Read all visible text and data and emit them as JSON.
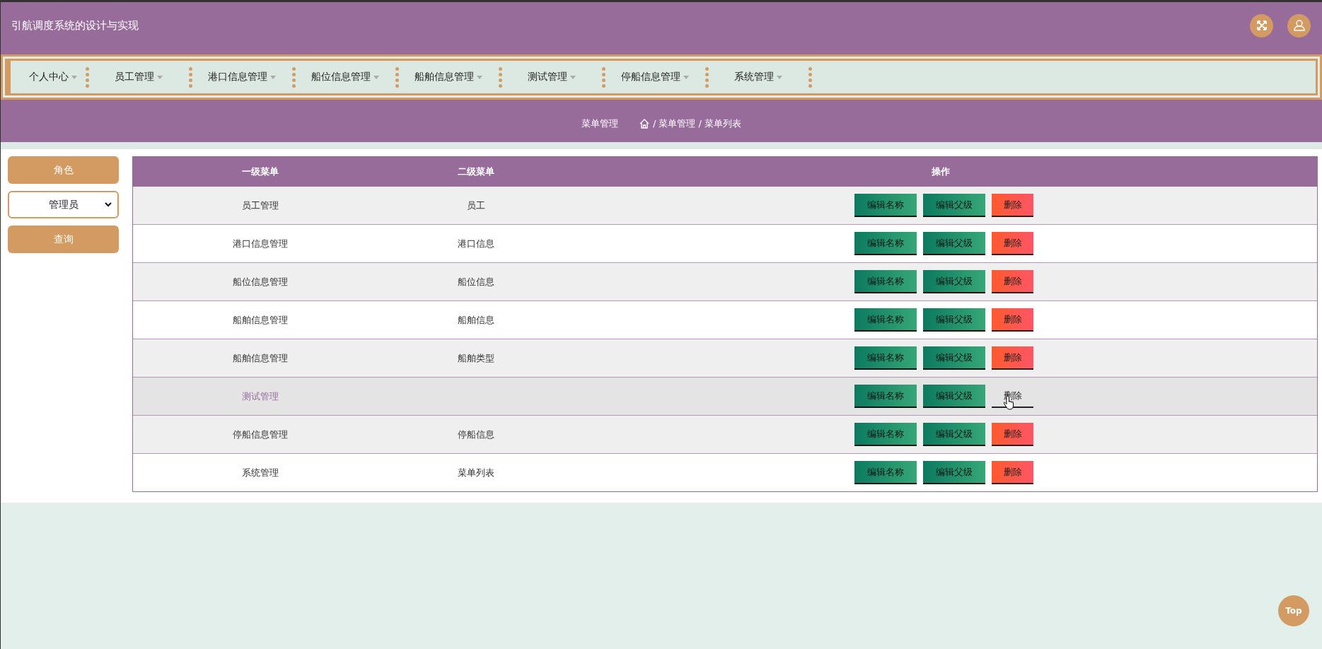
{
  "header": {
    "title": "引航调度系统的设计与实现"
  },
  "nav": [
    {
      "label": "个人中心"
    },
    {
      "label": "员工管理"
    },
    {
      "label": "港口信息管理"
    },
    {
      "label": "船位信息管理"
    },
    {
      "label": "船舶信息管理"
    },
    {
      "label": "测试管理"
    },
    {
      "label": "停船信息管理"
    },
    {
      "label": "系统管理"
    }
  ],
  "breadcrumb": {
    "title": "菜单管理",
    "path": "/ 菜单管理 / 菜单列表"
  },
  "sidebar": {
    "role_label": "角色",
    "role_select": "管理员",
    "query_button": "查询"
  },
  "table": {
    "columns": [
      "一级菜单",
      "二级菜单",
      "操作"
    ],
    "rows": [
      {
        "menu_level_1": "员工管理",
        "menu_level_2": "员工",
        "hovered": false,
        "actions": [
          "编辑名称",
          "编辑父级",
          "删除"
        ]
      },
      {
        "menu_level_1": "港口信息管理",
        "menu_level_2": "港口信息",
        "hovered": false,
        "actions": [
          "编辑名称",
          "编辑父级",
          "删除"
        ]
      },
      {
        "menu_level_1": "船位信息管理",
        "menu_level_2": "船位信息",
        "hovered": false,
        "actions": [
          "编辑名称",
          "编辑父级",
          "删除"
        ]
      },
      {
        "menu_level_1": "船舶信息管理",
        "menu_level_2": "船舶信息",
        "hovered": false,
        "actions": [
          "编辑名称",
          "编辑父级",
          "删除"
        ]
      },
      {
        "menu_level_1": "船舶信息管理",
        "menu_level_2": "船舶类型",
        "hovered": false,
        "actions": [
          "编辑名称",
          "编辑父级",
          "删除"
        ]
      },
      {
        "menu_level_1": "测试管理",
        "hovered": true,
        "actions": [
          "编辑名称",
          "编辑父级",
          "删除"
        ]
      },
      {
        "menu_level_1": "停船信息管理",
        "menu_level_2": "停船信息",
        "hovered": false,
        "actions": [
          "编辑名称",
          "编辑父级",
          "删除"
        ]
      },
      {
        "menu_level_1": "系统管理",
        "menu_level_2": "菜单列表",
        "hovered": false,
        "actions": [
          "编辑名称",
          "编辑父级",
          "删除"
        ]
      }
    ]
  },
  "back_to_top": "Top"
}
